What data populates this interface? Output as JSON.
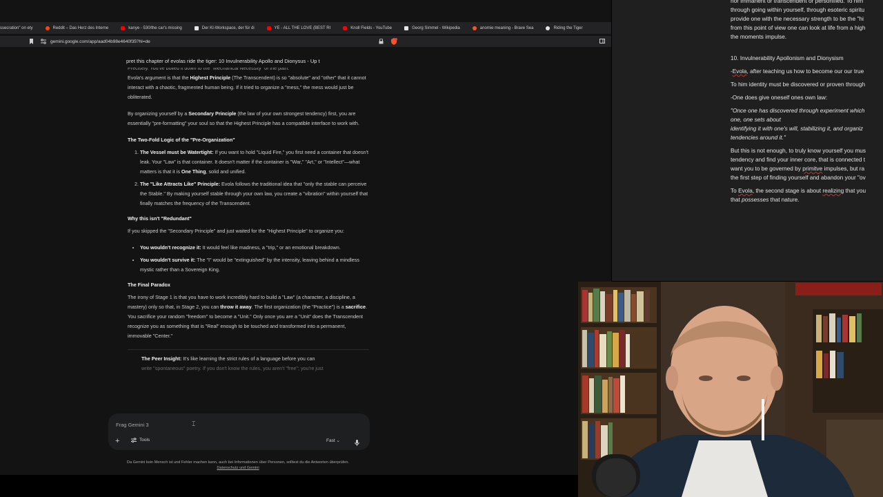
{
  "bookmarks": [
    {
      "label": "ssecration\" on ety",
      "color": "#d9d9d9"
    },
    {
      "label": "Reddit – Das Herz des Interne",
      "color": "#ff4500"
    },
    {
      "label": "kanye - 530/the car's missing",
      "color": "#ff0000"
    },
    {
      "label": "Der KI-Workspace, der für di",
      "color": "#e6e6e6"
    },
    {
      "label": "YE - ALL THE LOVE (BEST RI",
      "color": "#ff0000"
    },
    {
      "label": "Knoll Fields - YouTube",
      "color": "#ff0000"
    },
    {
      "label": "Georg Simmel - Wikipedia",
      "color": "#e6e6e6"
    },
    {
      "label": "anomie meaning - Brave Sea",
      "color": "#fb542b"
    },
    {
      "label": "Riding the Tiger",
      "color": "#e6e6e6"
    }
  ],
  "address": {
    "url": "gemini.google.com/app/aad04b98e4640f35?hl=de"
  },
  "gemini": {
    "conversation_title": "pret this chapter of evolas ride the tiger: 10 Invulnerability Apollo and Dionysus - Up t",
    "cut_line": "Precisely. You've boiled it down to the \"Mechanical Necessity\" of the path.",
    "para1_pre": "Evola's argument is that the ",
    "para1_bold": "Highest Principle",
    "para1_post": " (The Transcendent) is so \"absolute\" and \"other\" that it cannot interact with a chaotic, fragmented human being. If it tried to organize a \"mess,\" the mess would just be obliterated.",
    "para2_pre": "By organizing yourself by a ",
    "para2_bold": "Secondary Principle",
    "para2_post": " (the law of your own strongest tendency) first, you are essentially \"pre-formatting\" your soul so that the Highest Principle has a compatible interface to work with.",
    "heading1": "The Two-Fold Logic of the \"Pre-Organization\"",
    "item1_bold": "The Vessel must be Watertight:",
    "item1_text": " If you want to hold \"Liquid Fire,\" you first need a container that doesn't leak. Your \"Law\" is that container. It doesn't matter if the container is \"War,\" \"Art,\" or \"Intellect\"—what matters is that it is ",
    "item1_bold2": "One Thing",
    "item1_end": ", solid and unified.",
    "item2_bold": "The \"Like Attracts Like\" Principle:",
    "item2_text": " Evola follows the traditional idea that \"only the stable can perceive the Stable.\" By making yourself stable through your own law, you create a \"vibration\" within yourself that finally matches the frequency of the Transcendent.",
    "heading2": "Why this isn't \"Redundant\"",
    "para3": "If you skipped the \"Secondary Principle\" and just waited for the \"Highest Principle\" to organize you:",
    "bullet1_bold": "You wouldn't recognize it:",
    "bullet1_text": " It would feel like madness, a \"trip,\" or an emotional breakdown.",
    "bullet2_bold": "You wouldn't survive it:",
    "bullet2_text": " The \"I\" would be \"extinguished\" by the intensity, leaving behind a mindless mystic rather than a Sovereign King.",
    "heading3": "The Final Paradox",
    "para4_a": "The irony of Stage 1 is that you have to work incredibly hard to build a \"Law\" (a character, a discipline, a mastery) only so that, in Stage 2, you can ",
    "para4_b": "throw it away",
    "para4_c": ". The first organization (the \"Practice\") is a ",
    "para4_d": "sacrifice",
    "para4_e": ". You sacrifice your random \"freedom\" to become a \"Unit.\" Only once you are a \"Unit\" does the Transcendent recognize you as something that is \"Real\" enough to be touched and transformed into a permanent, immovable \"Center.\"",
    "peer_bold": "The Peer Insight:",
    "peer_text": " It's like learning the strict rules of a language before you can",
    "peer_dim": "write \"spontaneous\" poetry. If you don't know the rules, you aren't \"free\"; you're just",
    "input_placeholder": "Frag Gemini 3",
    "tools_label": "Tools",
    "mode_label": "Fast",
    "disclaimer": "Da Gemini kein Mensch ist und Fehler machen kann, auch bei Informationen über Personen, solltest du die Antworten überprüfen.",
    "privacy_link": "Datenschutz und Gemini"
  },
  "notes": {
    "l1": "nor immanent or transcendent or personified. To him",
    "l2": "through going within yourself, through esoteric spiritu",
    "l3": "provide one with the necessary strength to be the \"hi",
    "l4": "from this point of view one can look at life from a high",
    "l5": "the moments impulse.",
    "heading": "10. Invulnerability Apollonism and Dionysism",
    "l6a": "-",
    "l6b": "Evola",
    "l6c": ", after teaching us how to become our our true",
    "l7": "To him identity must be discovered or proven through",
    "l8": "-One does give oneself ones own law:",
    "q1": "\"Once one has discovered through experiment which",
    "q2": "one, one sets about",
    "q3": "identifying it with one's will, stabilizing it, and organiz",
    "q4": "tendencies around it.\"",
    "l9": "But this is not enough, to truly know yourself you mus",
    "l10": "tendency and find your inner core, that is connected t",
    "l11a": "want you to be governed by ",
    "l11b": "primitve",
    "l11c": " impulses, but ra",
    "l12": "the first step of finding yourself and abandon your \"ov",
    "l13a": "To ",
    "l13b": "Evola",
    "l13c": ", the second stage is about ",
    "l13d": "realizing",
    "l13e": " that you",
    "l14a": "that ",
    "l14b": "possesses",
    "l14c": " that nature."
  },
  "colors": {
    "page_bg": "#131314",
    "bar_bg": "#232325",
    "notes_bg": "#1f1f1f",
    "input_bg": "#1e1f20"
  }
}
